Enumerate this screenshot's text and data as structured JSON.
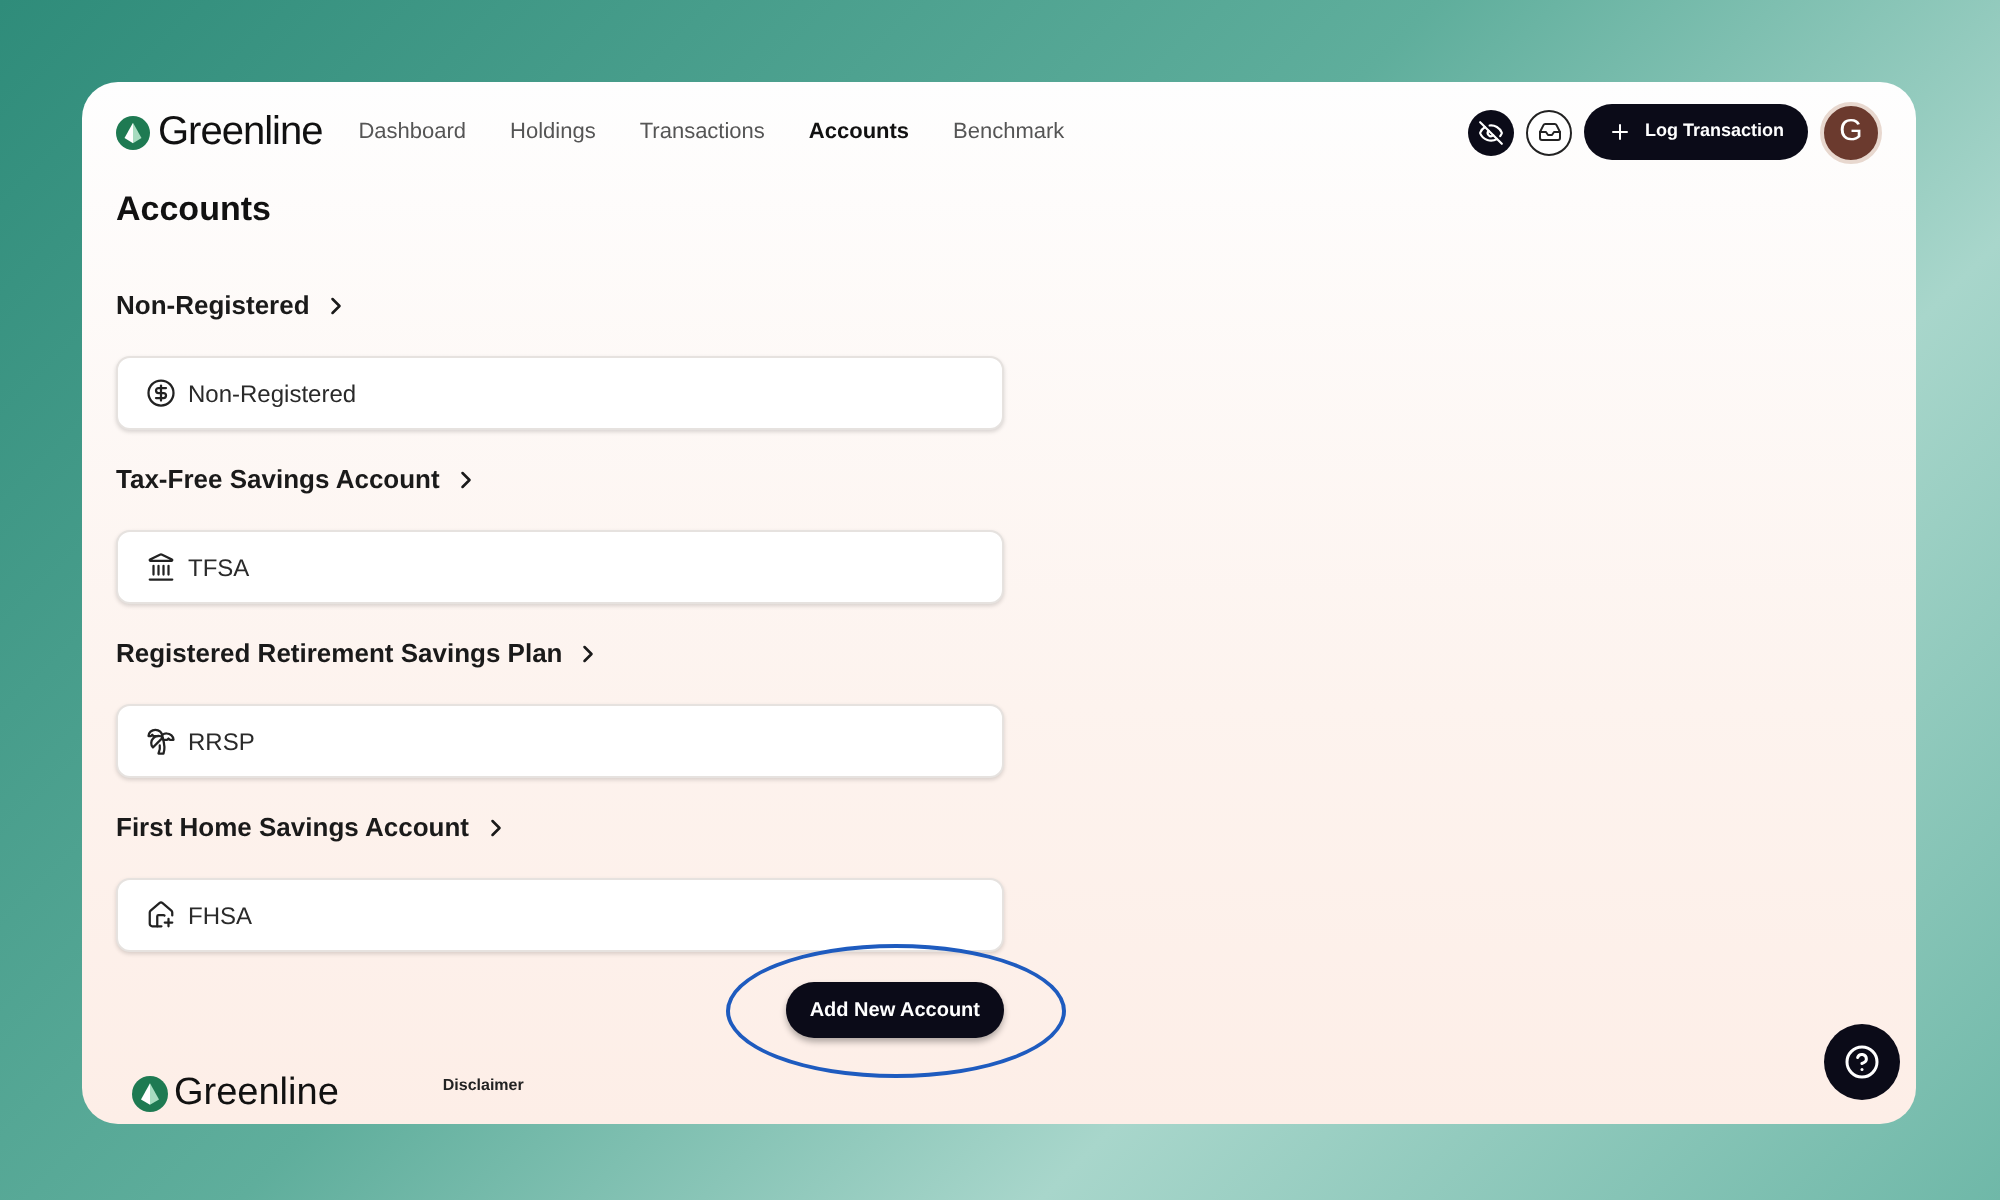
{
  "brand": "Greenline",
  "nav": [
    {
      "label": "Dashboard",
      "selected": false
    },
    {
      "label": "Holdings",
      "selected": false
    },
    {
      "label": "Transactions",
      "selected": false
    },
    {
      "label": "Accounts",
      "selected": true
    },
    {
      "label": "Benchmark",
      "selected": false
    }
  ],
  "log_transaction": "Log Transaction",
  "avatar": "G",
  "page_title": "Accounts",
  "sections": [
    {
      "heading": "Non-Registered",
      "account": {
        "name": "Non-Registered",
        "kind": "dollar"
      }
    },
    {
      "heading": "Tax-Free Savings Account",
      "account": {
        "name": "TFSA",
        "kind": "bank"
      }
    },
    {
      "heading": "Registered Retirement Savings Plan",
      "account": {
        "name": "RRSP",
        "kind": "palm"
      }
    },
    {
      "heading": "First Home Savings Account",
      "account": {
        "name": "FHSA",
        "kind": "house"
      }
    }
  ],
  "add_button": "Add New Account",
  "footer": {
    "brand": "Greenline",
    "link": "Disclaimer"
  }
}
